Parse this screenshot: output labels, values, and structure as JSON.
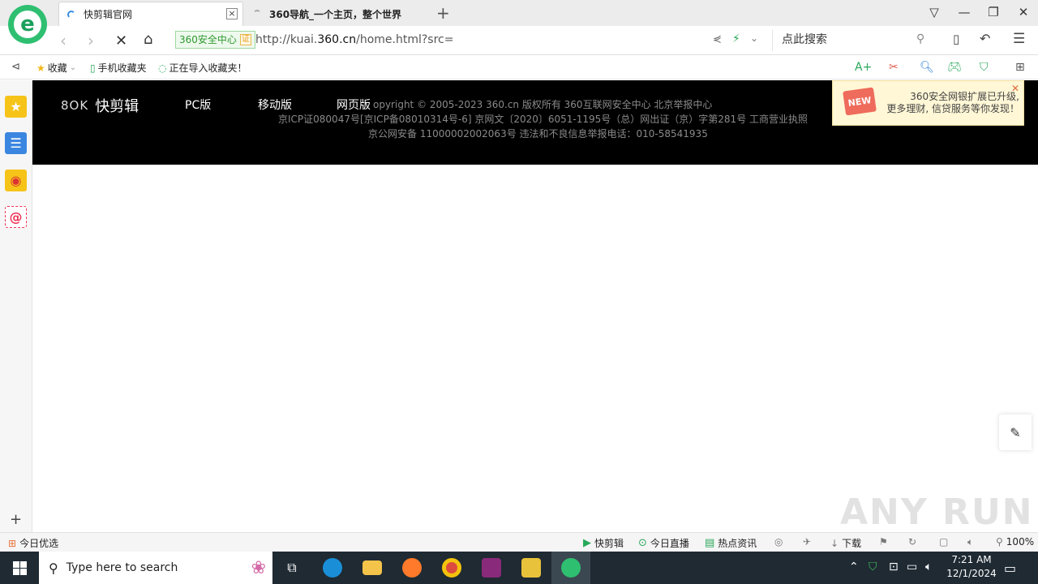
{
  "browser": {
    "tabs": [
      {
        "title": "快剪辑官网"
      },
      {
        "title": "360导航_一个主页，整个世界"
      }
    ],
    "security_badge": "360安全中心",
    "security_cert": "证",
    "url_prefix": "http://kuai.",
    "url_domain": "360.cn",
    "url_suffix": "/home.html?src=",
    "search_placeholder": "点此搜索"
  },
  "bookmarks": {
    "favorites": "收藏",
    "mobile": "手机收藏夹",
    "importing": "正在导入收藏夹！"
  },
  "page": {
    "brand": "快剪辑",
    "brand_mark": "8OK",
    "nav": [
      "PC版",
      "移动版",
      "网页版"
    ],
    "copyright_line1": "opyright © 2005-2023 360.cn 版权所有 360互联网安全中心 北京举报中心",
    "copyright_line2": "京ICP证080047号[京ICP备08010314号-6] 京网文〔2020〕6051-1195号（总）网出证（京）字第281号 工商营业执照",
    "copyright_line3": "京公网安备 11000002002063号   违法和不良信息举报电话：010-58541935"
  },
  "notification": {
    "badge": "NEW",
    "line1": "360安全网银扩展已升级,",
    "line2": "更多理财, 信贷服务等你发现！"
  },
  "statusbar": {
    "left": "今日优选",
    "items": [
      "快剪辑",
      "今日直播",
      "热点资讯"
    ],
    "download": "下载",
    "zoom": "100%"
  },
  "taskbar": {
    "search_placeholder": "Type here to search",
    "time": "7:21 AM",
    "date": "12/1/2024"
  },
  "watermark": "ANY RUN"
}
